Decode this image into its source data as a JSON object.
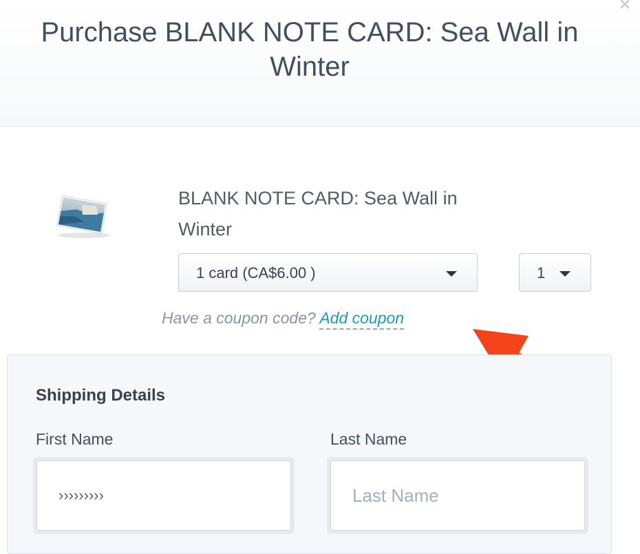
{
  "modal": {
    "title": "Purchase BLANK NOTE CARD: Sea Wall in Winter",
    "close_symbol": "×"
  },
  "product": {
    "name": "BLANK NOTE CARD: Sea Wall in Winter",
    "thumbnail_icon": "note-card-photo",
    "variant": "1 card (CA$6.00 )",
    "quantity": "1"
  },
  "coupon": {
    "prompt": "Have a coupon code?",
    "link_label": "Add coupon"
  },
  "annotation": {
    "arrow_color": "#f4431b"
  },
  "shipping": {
    "title": "Shipping Details",
    "first_name": {
      "label": "First Name",
      "value": "›››››››››"
    },
    "last_name": {
      "label": "Last Name",
      "value": "",
      "placeholder": "Last Name"
    }
  },
  "colors": {
    "link": "#1d97b7",
    "text": "#454e5e",
    "panel_bg": "#f5f7fa"
  }
}
